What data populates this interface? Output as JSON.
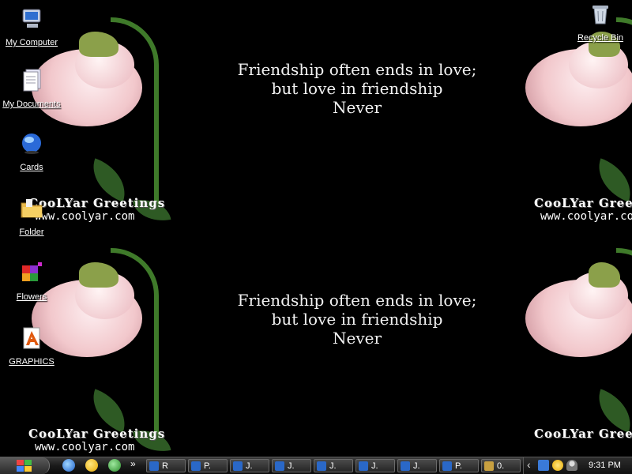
{
  "desktop": {
    "icons": [
      {
        "label": "My Computer",
        "icon": "my-computer-icon"
      },
      {
        "label": "My Documents",
        "icon": "my-documents-icon"
      },
      {
        "label": "Cards",
        "icon": "globe-icon"
      },
      {
        "label": "Folder",
        "icon": "folder-icon"
      },
      {
        "label": "Flowers",
        "icon": "cube-icon"
      },
      {
        "label": "GRAPHICS",
        "icon": "graphics-icon"
      },
      {
        "label": "Recycle Bin",
        "icon": "recycle-bin-icon"
      }
    ]
  },
  "wallpaper": {
    "quote_line1": "Friendship often ends in love;",
    "quote_line2": "but love in friendship",
    "quote_line3": "Never",
    "brand": "CooLYar Greetings",
    "url": "www.coolyar.com"
  },
  "taskbar": {
    "quick_launch": [
      "ie-icon",
      "messenger-icon",
      "contacts-icon"
    ],
    "overflow_label": "»",
    "buttons": [
      {
        "label": "R",
        "icon": "ie-icon"
      },
      {
        "label": "P.",
        "icon": "ie-icon"
      },
      {
        "label": "J.",
        "icon": "ie-icon"
      },
      {
        "label": "J.",
        "icon": "ie-icon"
      },
      {
        "label": "J.",
        "icon": "ie-icon"
      },
      {
        "label": "J.",
        "icon": "ie-icon"
      },
      {
        "label": "J.",
        "icon": "ie-icon"
      },
      {
        "label": "P.",
        "icon": "ie-icon"
      },
      {
        "label": "0.",
        "icon": "tool-icon"
      }
    ],
    "tray": {
      "collapse_label": "‹",
      "clock": "9:31 PM"
    }
  },
  "colors": {
    "petal": "#f2c8cc",
    "stem": "#3f7a2a",
    "taskbar": "#1a1a1a"
  }
}
